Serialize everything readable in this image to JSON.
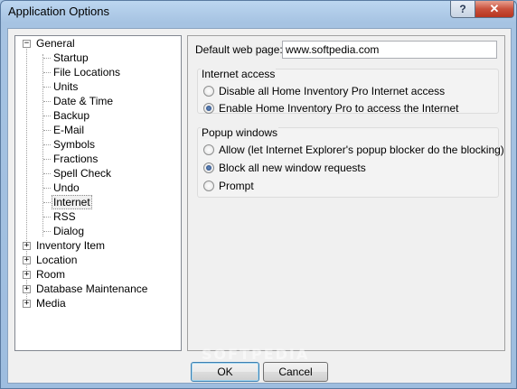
{
  "window": {
    "title": "Application Options",
    "help_label": "?",
    "close_label": "✕"
  },
  "tree": {
    "root": {
      "label": "General",
      "expanded": true
    },
    "children": [
      "Startup",
      "File Locations",
      "Units",
      "Date & Time",
      "Backup",
      "E-Mail",
      "Symbols",
      "Fractions",
      "Spell Check",
      "Undo",
      "Internet",
      "RSS",
      "Dialog"
    ],
    "selected": "Internet",
    "collapsed_roots": [
      "Inventory Item",
      "Location",
      "Room",
      "Database Maintenance",
      "Media"
    ]
  },
  "panel": {
    "default_web_page_label": "Default web page:",
    "default_web_page_value": "www.softpedia.com",
    "internet_access": {
      "title": "Internet access",
      "options": [
        "Disable all Home Inventory Pro Internet access",
        "Enable Home Inventory Pro to access the Internet"
      ],
      "selected_index": 1
    },
    "popup_windows": {
      "title": "Popup windows",
      "options": [
        "Allow (let Internet Explorer's popup blocker do the blocking)",
        "Block all new window requests",
        "Prompt"
      ],
      "selected_index": 1
    }
  },
  "buttons": {
    "ok": "OK",
    "cancel": "Cancel"
  },
  "watermark": "SOFTPEDIA"
}
